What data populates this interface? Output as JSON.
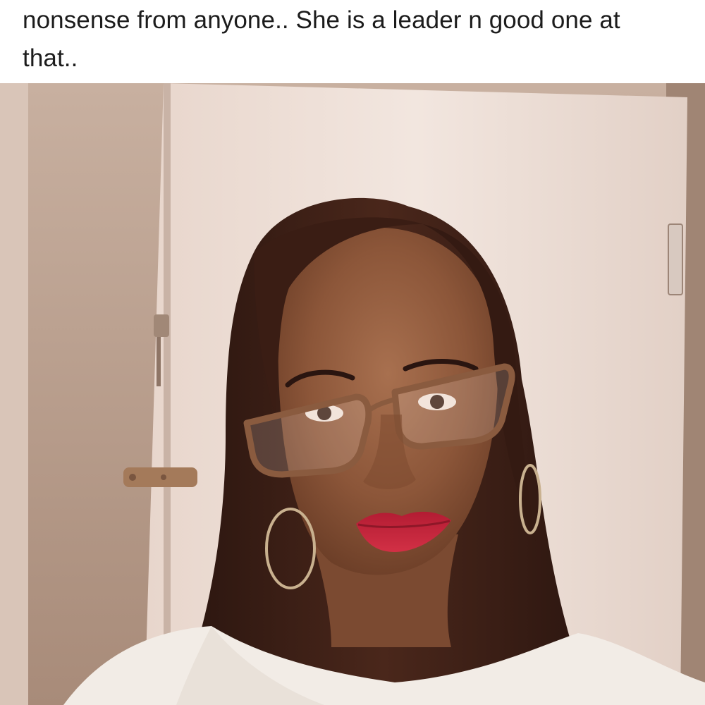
{
  "post": {
    "caption": "nonsense from anyone.. She is a leader n good one at\nthat.."
  },
  "photo": {
    "subject": "selfie-portrait"
  },
  "colors": {
    "caption_bg": "#ffffff",
    "caption_text": "#1c1c1c",
    "wall": "#b9a08e",
    "door": "#ecdcd4",
    "hair": "#3a1f17",
    "skin": "#8f5a3e",
    "lips": "#c2233a",
    "sweater": "#f2ece6"
  }
}
